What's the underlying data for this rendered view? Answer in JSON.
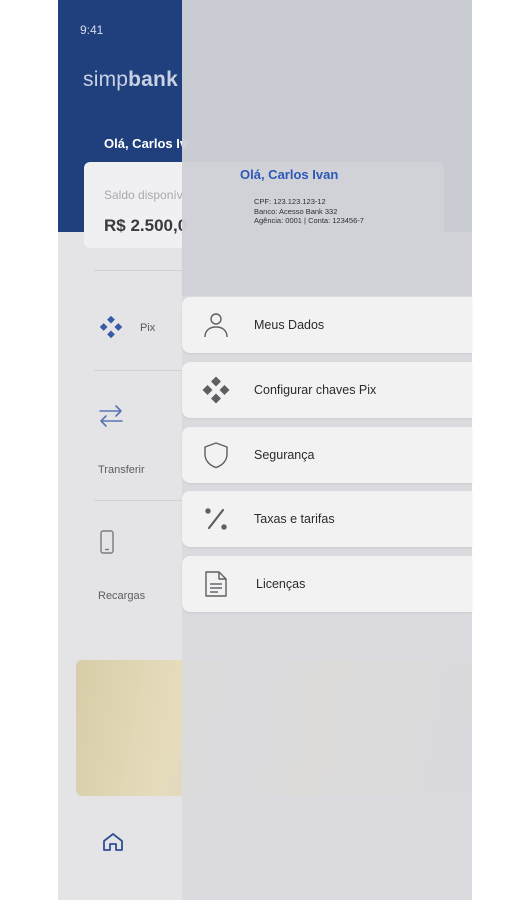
{
  "status_bar": {
    "time": "9:41"
  },
  "app": {
    "logo_light": "simp",
    "logo_bold": "bank",
    "greeting": "Olá, Carlos Iv",
    "balance_label": "Saldo disponív",
    "balance_value": "R$ 2.500,0"
  },
  "actions": [
    {
      "label": "Pix",
      "icon": "pix-icon"
    },
    {
      "label": "Transferir",
      "icon": "transfer-arrows-icon"
    },
    {
      "label": "Recargas",
      "icon": "phone-icon"
    }
  ],
  "bottom_nav": {
    "active_icon": "home-icon"
  },
  "drawer": {
    "user": {
      "name": "Olá, Carlos Ivan",
      "cpf": "CPF: 123.123.123-12",
      "bank": "Banco: Acesso Bank 332",
      "account": "Agência: 0001 | Conta: 123456-7"
    },
    "menu": [
      {
        "label": "Meus Dados",
        "icon": "user-icon"
      },
      {
        "label": "Configurar chaves Pix",
        "icon": "pix-icon"
      },
      {
        "label": "Segurança",
        "icon": "shield-icon"
      },
      {
        "label": "Taxas e tarifas",
        "icon": "percent-icon"
      },
      {
        "label": "Licenças",
        "icon": "document-icon"
      }
    ]
  },
  "colors": {
    "brand_blue": "#1f3f7d",
    "drawer_name": "#2c58b8",
    "menu_background": "#f2f2f3"
  }
}
